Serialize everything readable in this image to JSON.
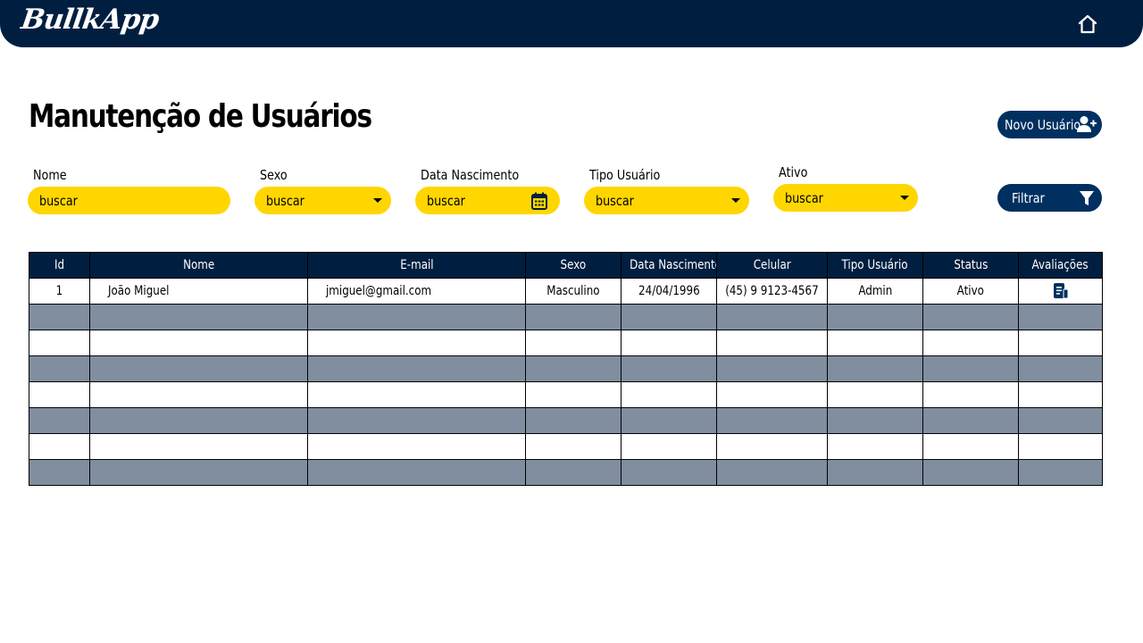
{
  "app": {
    "logo": "BullkApp"
  },
  "page": {
    "title": "Manutenção de Usuários"
  },
  "actions": {
    "new_user": "Novo Usuário",
    "filter": "Filtrar"
  },
  "filters": {
    "nome": {
      "label": "Nome",
      "placeholder": "buscar"
    },
    "sexo": {
      "label": "Sexo",
      "placeholder": "buscar"
    },
    "data_nascimento": {
      "label": "Data Nascimento",
      "placeholder": "buscar"
    },
    "tipo_usuario": {
      "label": "Tipo Usuário",
      "placeholder": "buscar"
    },
    "ativo": {
      "label": "Ativo",
      "placeholder": "buscar"
    }
  },
  "table": {
    "headers": [
      "Id",
      "Nome",
      "E-mail",
      "Sexo",
      "Data Nascimento",
      "Celular",
      "Tipo Usuário",
      "Status",
      "Avaliações"
    ],
    "rows": [
      {
        "id": "1",
        "nome": "João Miguel",
        "email": "jmiguel@gmail.com",
        "sexo": "Masculino",
        "data_nascimento": "24/04/1996",
        "celular": "(45) 9 9123-4567",
        "tipo_usuario": "Admin",
        "status": "Ativo",
        "avaliacoes_icon": "document-icon"
      }
    ]
  },
  "colors": {
    "navy": "#001f40",
    "accent_yellow": "#ffd600",
    "button_blue": "#003060",
    "row_alt": "#818ea0"
  }
}
